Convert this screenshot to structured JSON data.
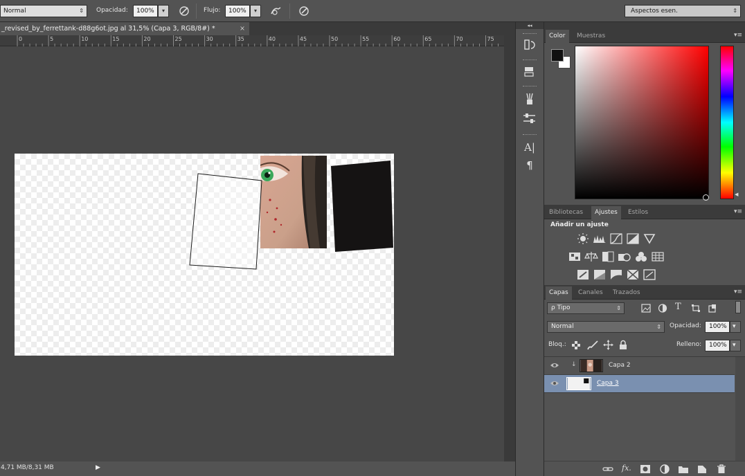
{
  "options_bar": {
    "mode": "Normal",
    "opacity_label": "Opacidad:",
    "opacity_value": "100%",
    "flow_label": "Flujo:",
    "flow_value": "100%",
    "workspace": "Aspectos esen."
  },
  "document": {
    "tab_title": "_revised_by_ferrettank-d88g6ot.jpg al 31,5% (Capa 3, RGB/8#) *",
    "close_glyph": "×",
    "ruler_ticks": [
      "0",
      "5",
      "10",
      "15",
      "20",
      "25",
      "30",
      "35",
      "40",
      "45",
      "50",
      "55",
      "60",
      "65",
      "70",
      "75"
    ],
    "status": "4,71 MB/8,31 MB",
    "status_arrow": "▶"
  },
  "panel_menu_glyph": "▾≡",
  "collapse_glyph": "◂◂",
  "color_panel": {
    "tabs": [
      "Color",
      "Muestras"
    ],
    "foreground": "#111111",
    "background": "#ffffff"
  },
  "adjustments_panel": {
    "tabs": [
      "Bibliotecas",
      "Ajustes",
      "Estilos"
    ],
    "heading": "Añadir un ajuste",
    "icons": [
      "brightness-icon",
      "levels-icon",
      "curves-icon",
      "exposure-icon",
      "vibrance-icon",
      "hue-saturation-icon",
      "color-balance-icon",
      "black-white-icon",
      "photo-filter-icon",
      "channel-mixer-icon",
      "color-lookup-icon",
      "invert-icon",
      "posterize-icon",
      "threshold-icon",
      "gradient-map-icon",
      "selective-color-icon"
    ]
  },
  "layers_panel": {
    "tabs": [
      "Capas",
      "Canales",
      "Trazados"
    ],
    "filter": "ρ Tipo",
    "blend_mode": "Normal",
    "opacity_label": "Opacidad:",
    "opacity_value": "100%",
    "lock_label": "Bloq.:",
    "fill_label": "Relleno:",
    "fill_value": "100%",
    "layers": [
      {
        "name": "Capa 2",
        "visible": true,
        "clipped": true,
        "selected": false
      },
      {
        "name": "Capa 3",
        "visible": true,
        "clipped": false,
        "selected": true
      }
    ]
  },
  "colors": {
    "app_bg": "#535353",
    "canvas_bg": "#474747",
    "selected_layer": "#7a90b0"
  }
}
